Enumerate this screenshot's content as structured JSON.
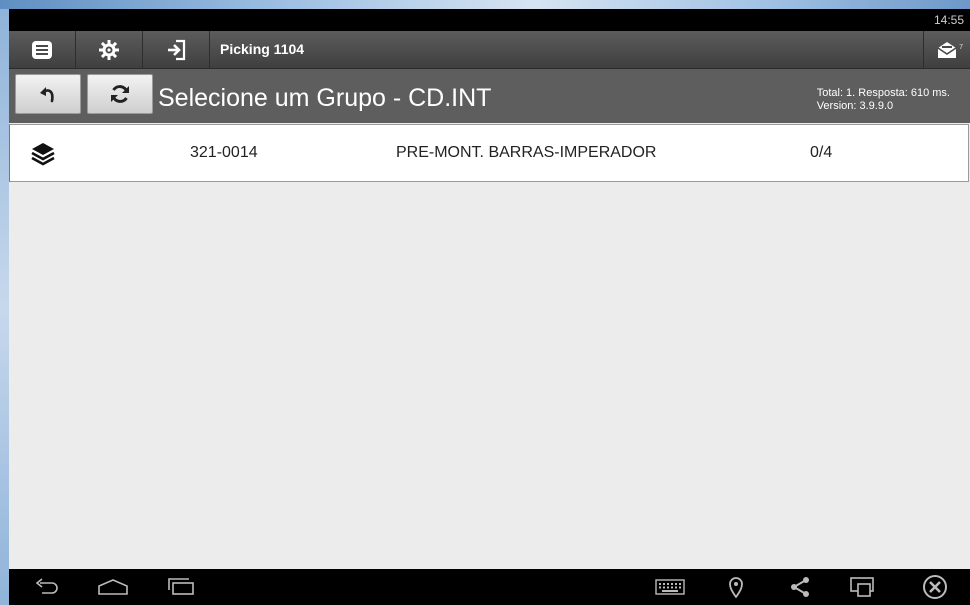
{
  "status_bar": {
    "time": "14:55"
  },
  "toolbar": {
    "title": "Picking 1104",
    "mail_badge": "7"
  },
  "header": {
    "title": "Selecione um Grupo - CD.INT",
    "info_line1": "Total: 1. Resposta: 610 ms.",
    "info_line2": "Version: 3.9.9.0"
  },
  "groups": [
    {
      "code": "321-0014",
      "description": "PRE-MONT. BARRAS-IMPERADOR",
      "progress": "0/4"
    }
  ],
  "icons": {
    "menu": "list-icon",
    "settings": "gear-icon",
    "login": "sign-in-icon",
    "mail": "mail-icon",
    "back": "undo-icon",
    "refresh": "refresh-icon",
    "group": "layers-icon",
    "nav_back": "back-icon",
    "nav_home": "home-icon",
    "nav_recent": "recent-apps-icon",
    "keyboard": "keyboard-icon",
    "location": "location-icon",
    "share": "share-icon",
    "window": "window-icon",
    "close": "close-icon"
  },
  "colors": {
    "toolbar_bg": "#4a4a4a",
    "header_bg": "#5e5e5e",
    "content_bg": "#ececec",
    "row_bg": "#ffffff"
  }
}
